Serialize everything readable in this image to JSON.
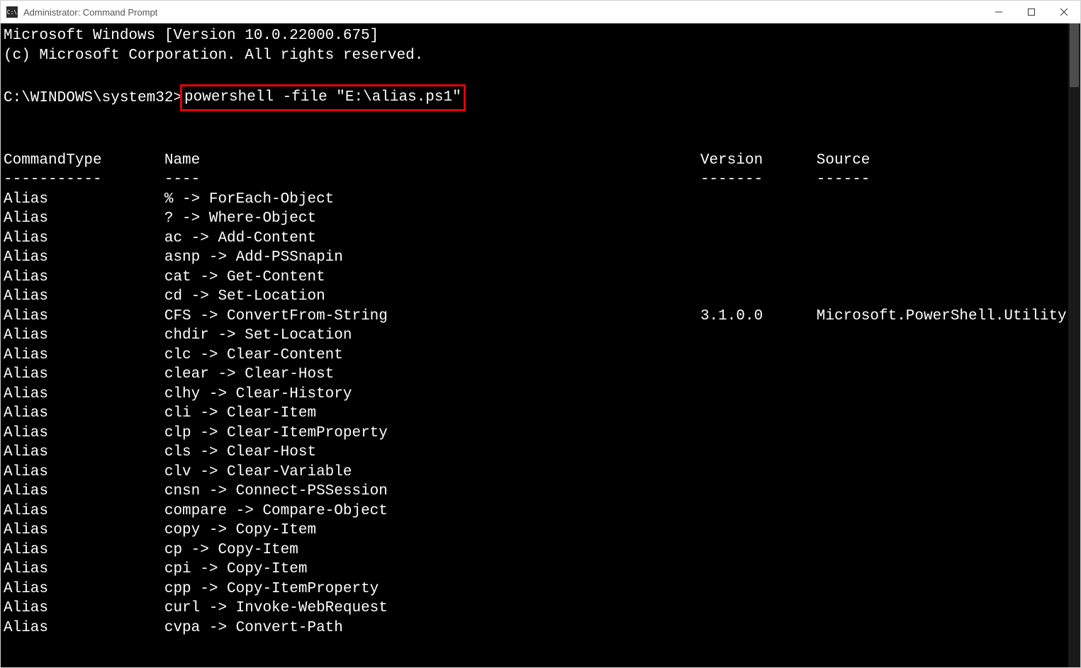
{
  "window": {
    "title": "Administrator: Command Prompt",
    "icon_label": "C:\\"
  },
  "terminal": {
    "banner_line1": "Microsoft Windows [Version 10.0.22000.675]",
    "banner_line2": "(c) Microsoft Corporation. All rights reserved.",
    "prompt": "C:\\WINDOWS\\system32>",
    "command": "powershell -file \"E:\\alias.ps1\"",
    "columns": {
      "col1": "CommandType",
      "col2": "Name",
      "col3": "Version",
      "col4": "Source",
      "sep1": "-----------",
      "sep2": "----",
      "sep3": "-------",
      "sep4": "------"
    },
    "rows": [
      {
        "type": "Alias",
        "name": "% -> ForEach-Object",
        "version": "",
        "source": ""
      },
      {
        "type": "Alias",
        "name": "? -> Where-Object",
        "version": "",
        "source": ""
      },
      {
        "type": "Alias",
        "name": "ac -> Add-Content",
        "version": "",
        "source": ""
      },
      {
        "type": "Alias",
        "name": "asnp -> Add-PSSnapin",
        "version": "",
        "source": ""
      },
      {
        "type": "Alias",
        "name": "cat -> Get-Content",
        "version": "",
        "source": ""
      },
      {
        "type": "Alias",
        "name": "cd -> Set-Location",
        "version": "",
        "source": ""
      },
      {
        "type": "Alias",
        "name": "CFS -> ConvertFrom-String",
        "version": "3.1.0.0",
        "source": "Microsoft.PowerShell.Utility"
      },
      {
        "type": "Alias",
        "name": "chdir -> Set-Location",
        "version": "",
        "source": ""
      },
      {
        "type": "Alias",
        "name": "clc -> Clear-Content",
        "version": "",
        "source": ""
      },
      {
        "type": "Alias",
        "name": "clear -> Clear-Host",
        "version": "",
        "source": ""
      },
      {
        "type": "Alias",
        "name": "clhy -> Clear-History",
        "version": "",
        "source": ""
      },
      {
        "type": "Alias",
        "name": "cli -> Clear-Item",
        "version": "",
        "source": ""
      },
      {
        "type": "Alias",
        "name": "clp -> Clear-ItemProperty",
        "version": "",
        "source": ""
      },
      {
        "type": "Alias",
        "name": "cls -> Clear-Host",
        "version": "",
        "source": ""
      },
      {
        "type": "Alias",
        "name": "clv -> Clear-Variable",
        "version": "",
        "source": ""
      },
      {
        "type": "Alias",
        "name": "cnsn -> Connect-PSSession",
        "version": "",
        "source": ""
      },
      {
        "type": "Alias",
        "name": "compare -> Compare-Object",
        "version": "",
        "source": ""
      },
      {
        "type": "Alias",
        "name": "copy -> Copy-Item",
        "version": "",
        "source": ""
      },
      {
        "type": "Alias",
        "name": "cp -> Copy-Item",
        "version": "",
        "source": ""
      },
      {
        "type": "Alias",
        "name": "cpi -> Copy-Item",
        "version": "",
        "source": ""
      },
      {
        "type": "Alias",
        "name": "cpp -> Copy-ItemProperty",
        "version": "",
        "source": ""
      },
      {
        "type": "Alias",
        "name": "curl -> Invoke-WebRequest",
        "version": "",
        "source": ""
      },
      {
        "type": "Alias",
        "name": "cvpa -> Convert-Path",
        "version": "",
        "source": ""
      }
    ]
  },
  "layout": {
    "col1_width": 18,
    "col2_width": 60,
    "col3_width": 13
  }
}
